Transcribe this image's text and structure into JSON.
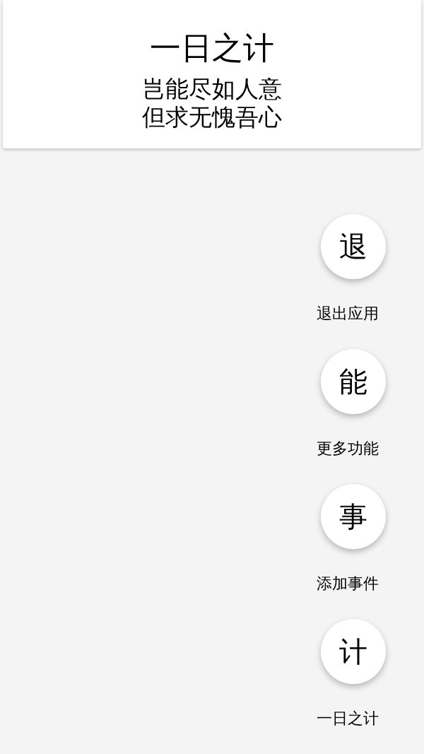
{
  "header": {
    "title": "一日之计",
    "subtitle_lines": [
      "岂能尽如人意",
      "但求无愧吾心"
    ]
  },
  "actions": [
    {
      "glyph": "退",
      "label": "退出应用"
    },
    {
      "glyph": "能",
      "label": "更多功能"
    },
    {
      "glyph": "事",
      "label": "添加事件"
    },
    {
      "glyph": "计",
      "label": "一日之计"
    }
  ]
}
